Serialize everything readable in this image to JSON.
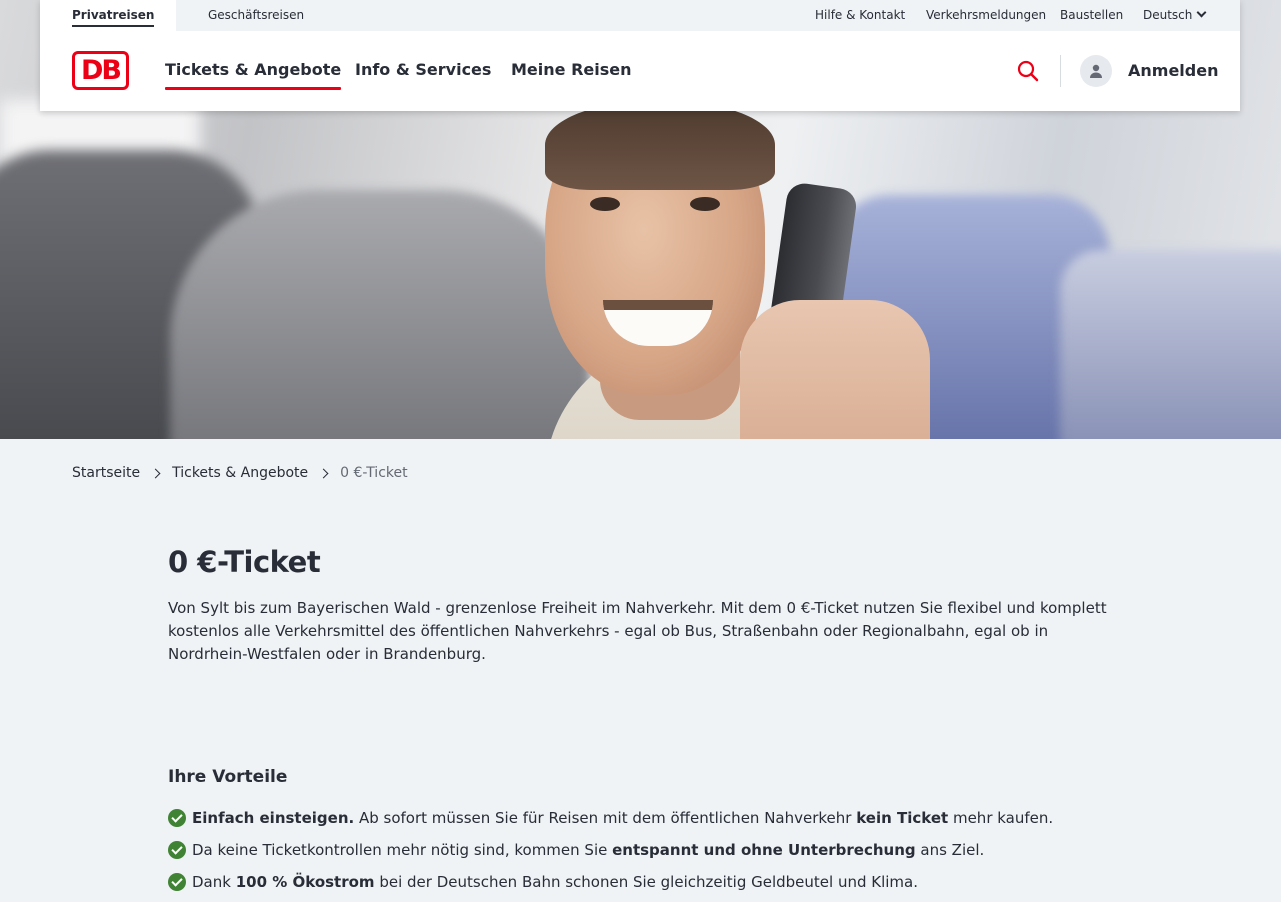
{
  "meta_nav": {
    "tabs": [
      "Privatreisen",
      "Geschäftsreisen"
    ],
    "links": [
      "Hilfe & Kontakt",
      "Verkehrsmeldungen",
      "Baustellen",
      "Deutsch"
    ]
  },
  "brand": {
    "logo_text": "DB",
    "accent_color": "#ec0016"
  },
  "main_nav": {
    "items": [
      "Tickets & Angebote",
      "Info & Services",
      "Meine Reisen"
    ],
    "active": "Tickets & Angebote"
  },
  "header_actions": {
    "search_icon": "search-icon",
    "user_icon": "user-icon",
    "login_label": "Anmelden"
  },
  "breadcrumb": [
    "Startseite",
    "Tickets & Angebote",
    "0 €-Ticket"
  ],
  "page": {
    "title": "0 €-Ticket",
    "intro": "Von Sylt bis zum Bayerischen Wald - grenzenlose Freiheit im Nahverkehr. Mit dem 0 €-Ticket nutzen Sie flexibel und komplett kostenlos alle Verkehrsmittel des öffentlichen Nahverkehrs - egal ob Bus, Straßenbahn oder Regionalbahn, egal ob in Nordrhein-Westfalen oder in Brandenburg.",
    "benefits_heading": "Ihre Vorteile",
    "benefits": [
      {
        "b1": "Einfach einsteigen.",
        "t1": " Ab sofort müssen Sie für Reisen mit dem öffentlichen Nahverkehr ",
        "b2": "kein Ticket",
        "t2": " mehr kaufen."
      },
      {
        "t0": "Da keine Ticketkontrollen mehr nötig sind, kommen Sie ",
        "b1": "entspannt und ohne Unterbrechung",
        "t1": " ans Ziel."
      },
      {
        "t0": "Dank ",
        "b1": "100 % Ökostrom",
        "t1": " bei der Deutschen Bahn schonen Sie gleichzeitig Geldbeutel und Klima."
      }
    ],
    "check_icon": "check-circle-icon",
    "check_color": "#408335"
  }
}
